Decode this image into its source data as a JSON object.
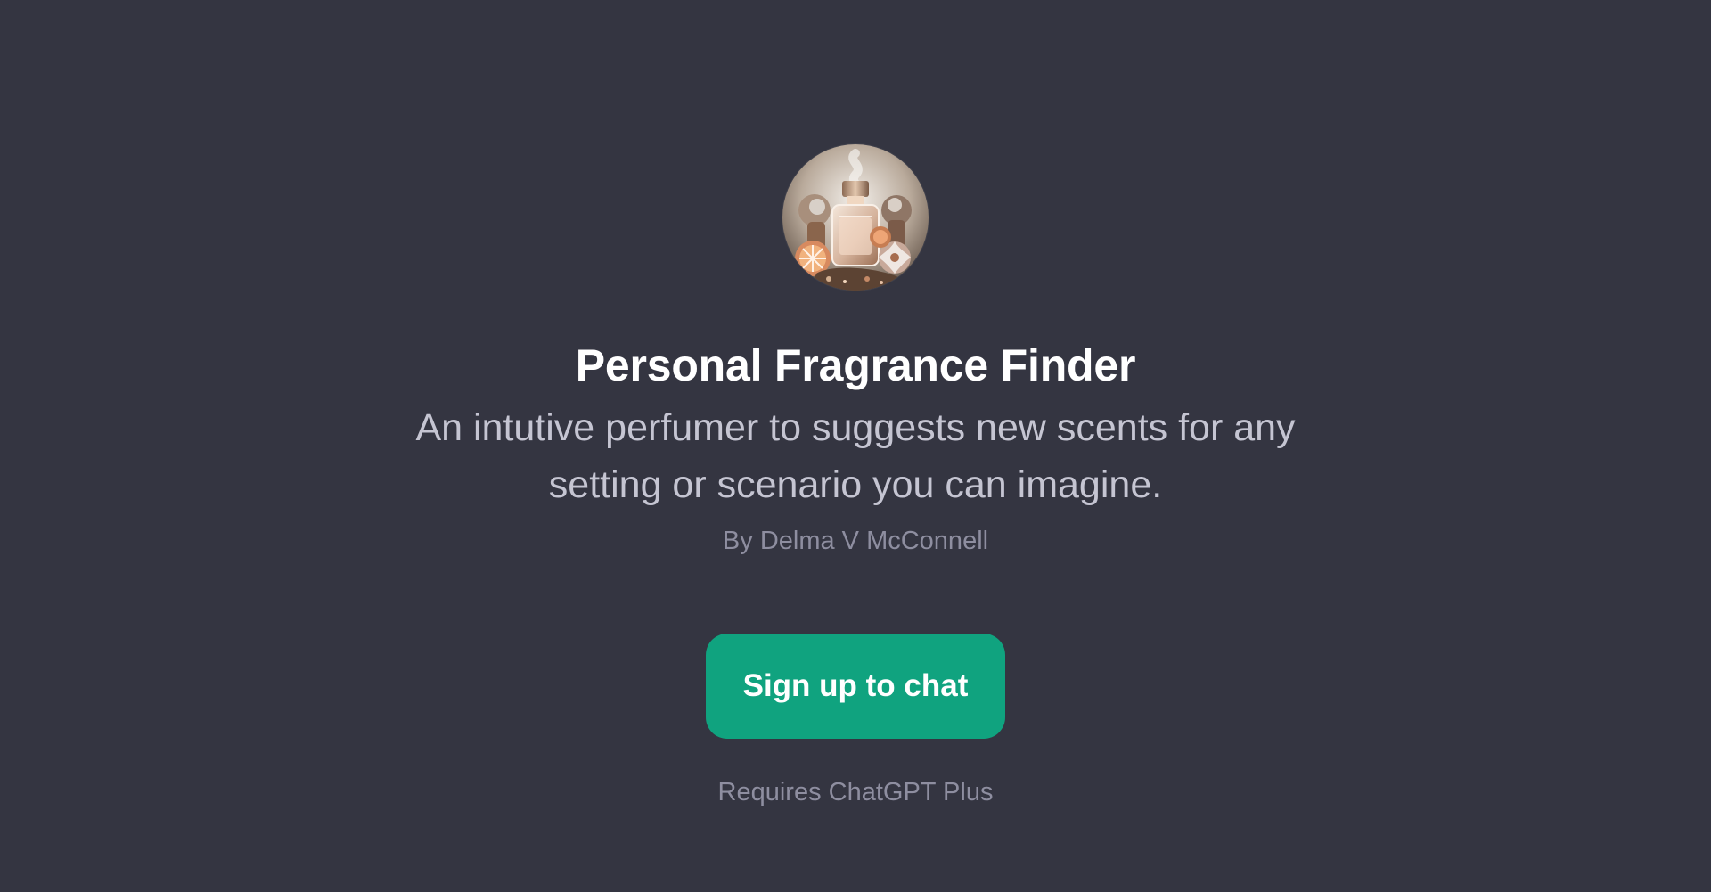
{
  "app": {
    "name": "Personal Fragrance Finder",
    "description": "An intutive perfumer to suggests new scents for any setting or scenario you can imagine.",
    "author": "By Delma V McConnell"
  },
  "actions": {
    "signup_label": "Sign up to chat"
  },
  "footer": {
    "requirement": "Requires ChatGPT Plus"
  },
  "avatar": {
    "icon": "perfume-bottle-avatar-icon"
  },
  "colors": {
    "background": "#343541",
    "accent": "#10a37f",
    "title": "#ffffff",
    "description": "#c5c5d2",
    "muted": "#8e8ea0"
  }
}
